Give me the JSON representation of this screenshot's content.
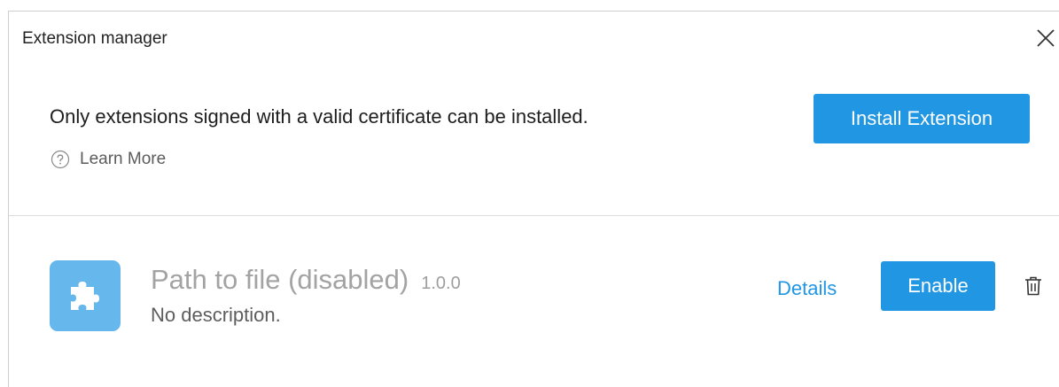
{
  "dialog": {
    "title": "Extension manager",
    "close_icon": "close-icon"
  },
  "header": {
    "notice": "Only extensions signed with a valid certificate can be installed.",
    "learn_more_label": "Learn More",
    "learn_more_icon": "help-circle-icon",
    "install_button_label": "Install Extension"
  },
  "extensions": [
    {
      "icon": "puzzle-piece-icon",
      "name": "Path to file (disabled)",
      "version": "1.0.0",
      "description": "No description.",
      "details_label": "Details",
      "enable_label": "Enable",
      "delete_icon": "trash-icon"
    }
  ],
  "colors": {
    "accent": "#2196e3",
    "extension_icon_bg": "#66b7ec",
    "disabled_text": "#a3a3a3"
  }
}
